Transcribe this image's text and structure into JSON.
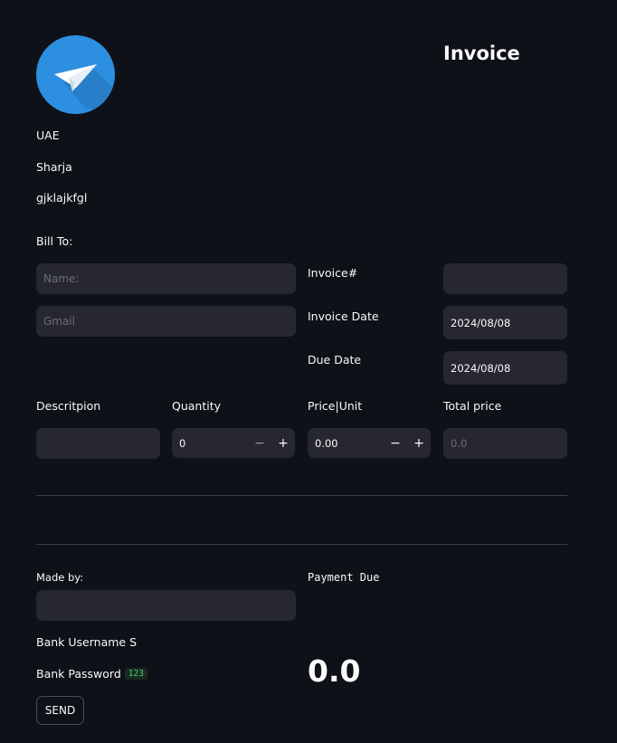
{
  "header": {
    "title": "Invoice",
    "logo_icon": "paper-plane-icon",
    "logo_color": "#2d8fe0"
  },
  "sender": {
    "country": "UAE",
    "city": "Sharja",
    "address": "gjklajkfgl"
  },
  "bill_to": {
    "label": "Bill To:",
    "name_placeholder": "Name:",
    "gmail_placeholder": "Gmail",
    "name_value": "",
    "gmail_value": ""
  },
  "invoice_meta": {
    "invoice_number_label": "Invoice#",
    "invoice_number_value": "",
    "invoice_date_label": "Invoice Date",
    "invoice_date_value": "2024/08/08",
    "due_date_label": "Due Date",
    "due_date_value": "2024/08/08"
  },
  "line_item": {
    "description_label": "Descritpion",
    "quantity_label": "Quantity",
    "price_label": "Price|Unit",
    "total_label": "Total price",
    "description_value": "",
    "quantity_value": "0",
    "price_value": "0.00",
    "total_placeholder": "0.0",
    "minus_symbol": "−",
    "plus_symbol": "+"
  },
  "footer": {
    "made_by_label": "Made by:",
    "made_by_value": "",
    "bank_username_label": "Bank Username S",
    "bank_password_label": "Bank Password",
    "bank_password_badge": "123",
    "payment_due_label": "Payment Due",
    "payment_due_value": "0.0",
    "send_label": "SEND"
  },
  "colors": {
    "background": "#0e1117",
    "field": "#262730",
    "accent_green": "#3dd56d"
  }
}
